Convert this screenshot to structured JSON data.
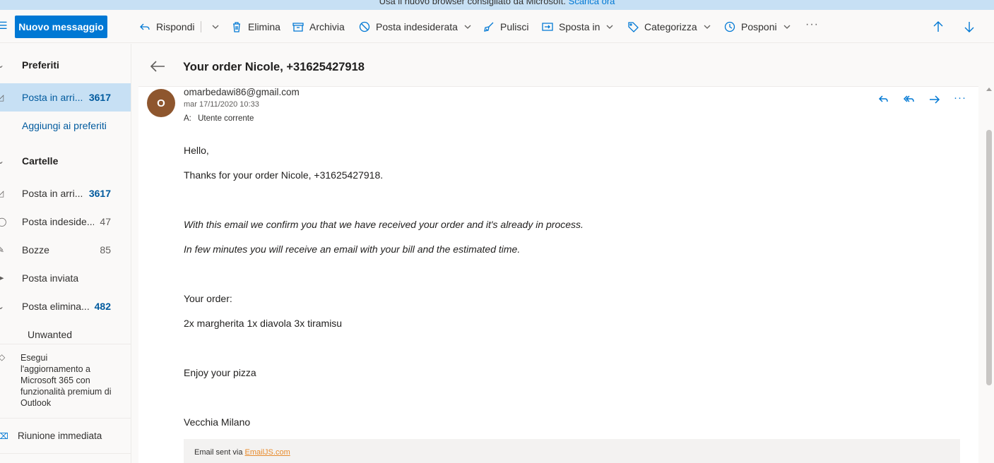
{
  "banner": {
    "text": "Usa il nuovo browser consigliato da Microsoft.",
    "link": "Scarica ora"
  },
  "toolbar": {
    "new_message": "Nuovo messaggio",
    "reply": "Rispondi",
    "delete": "Elimina",
    "archive": "Archivia",
    "junk": "Posta indesiderata",
    "sweep": "Pulisci",
    "move_to": "Sposta in",
    "categorize": "Categorizza",
    "snooze": "Posponi",
    "more": "···"
  },
  "sidebar": {
    "favorites_header": "Preferiti",
    "favorites": [
      {
        "label": "Posta in arri...",
        "count": "3617"
      }
    ],
    "add_favorites": "Aggiungi ai preferiti",
    "folders_header": "Cartelle",
    "folders": [
      {
        "label": "Posta in arri...",
        "count": "3617"
      },
      {
        "label": "Posta indeside...",
        "count": "47"
      },
      {
        "label": "Bozze",
        "count": "85"
      },
      {
        "label": "Posta inviata",
        "count": ""
      },
      {
        "label": "Posta elimina...",
        "count": "482"
      },
      {
        "label": "Unwanted",
        "count": ""
      }
    ],
    "upgrade": "Esegui l'aggiornamento a Microsoft 365 con funzionalità premium di Outlook",
    "meeting": "Riunione immediata"
  },
  "message": {
    "subject": "Your order Nicole, +31625427918",
    "avatar_initial": "O",
    "avatar_color": "#8e562e",
    "sender": "omarbedawi86@gmail.com",
    "date": "mar 17/11/2020 10:33",
    "to_label": "A:",
    "to": "Utente corrente",
    "body": {
      "greeting": "Hello,",
      "thanks": "Thanks for your order Nicole, +31625427918.",
      "confirm": "With this email we confirm you that we have received your order and it's already in process.",
      "bill": "In few minutes you will receive an email with your bill and the estimated time.",
      "order_label": "Your order:",
      "order_items": "2x margherita 1x diavola 3x tiramisu",
      "enjoy": "Enjoy your pizza",
      "signature": "Vecchia Milano"
    },
    "footer_text": "Email sent via",
    "footer_link": "EmailJS.com"
  },
  "colors": {
    "accent": "#0078d4",
    "selected": "#c7e0f4"
  }
}
